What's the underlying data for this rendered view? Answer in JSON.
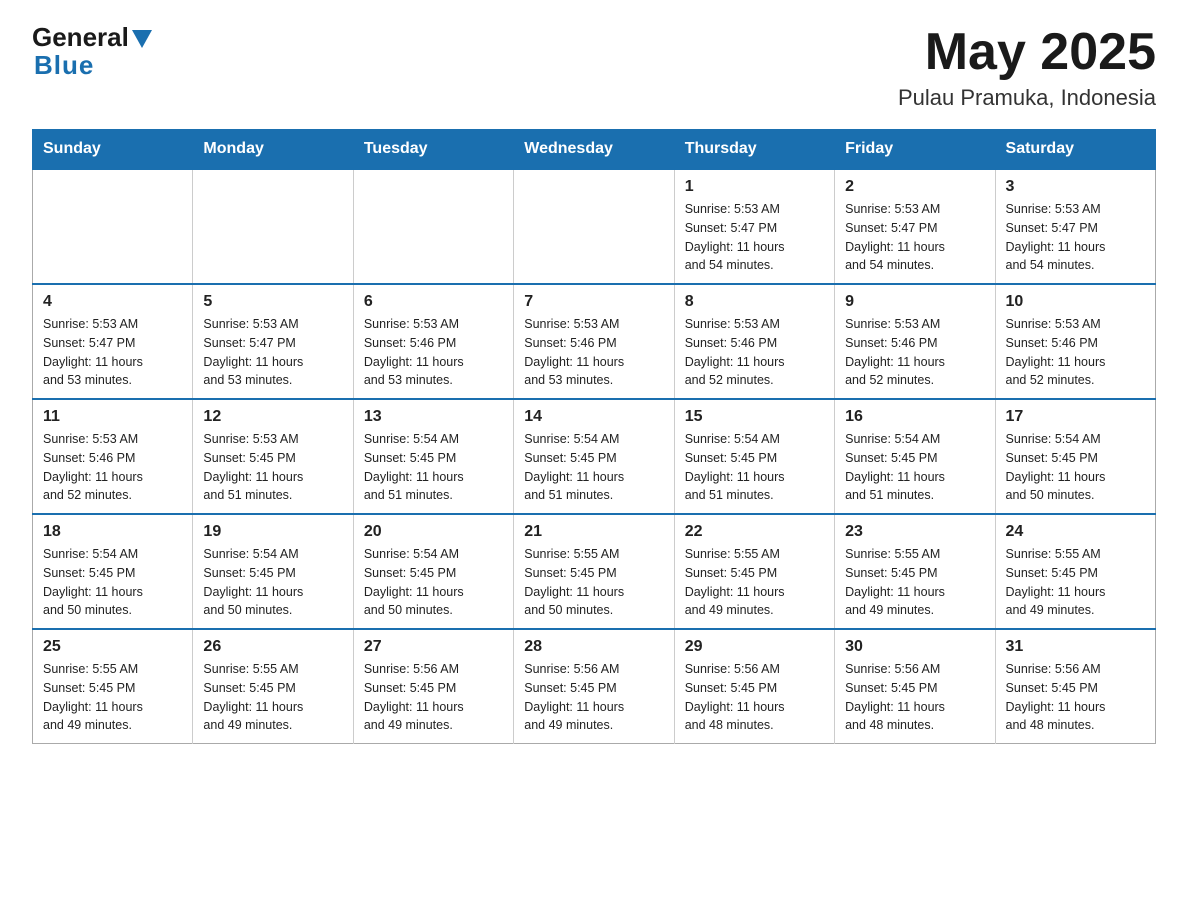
{
  "logo": {
    "general": "General",
    "blue": "Blue"
  },
  "title": "May 2025",
  "subtitle": "Pulau Pramuka, Indonesia",
  "weekdays": [
    "Sunday",
    "Monday",
    "Tuesday",
    "Wednesday",
    "Thursday",
    "Friday",
    "Saturday"
  ],
  "weeks": [
    [
      {
        "day": "",
        "info": ""
      },
      {
        "day": "",
        "info": ""
      },
      {
        "day": "",
        "info": ""
      },
      {
        "day": "",
        "info": ""
      },
      {
        "day": "1",
        "info": "Sunrise: 5:53 AM\nSunset: 5:47 PM\nDaylight: 11 hours\nand 54 minutes."
      },
      {
        "day": "2",
        "info": "Sunrise: 5:53 AM\nSunset: 5:47 PM\nDaylight: 11 hours\nand 54 minutes."
      },
      {
        "day": "3",
        "info": "Sunrise: 5:53 AM\nSunset: 5:47 PM\nDaylight: 11 hours\nand 54 minutes."
      }
    ],
    [
      {
        "day": "4",
        "info": "Sunrise: 5:53 AM\nSunset: 5:47 PM\nDaylight: 11 hours\nand 53 minutes."
      },
      {
        "day": "5",
        "info": "Sunrise: 5:53 AM\nSunset: 5:47 PM\nDaylight: 11 hours\nand 53 minutes."
      },
      {
        "day": "6",
        "info": "Sunrise: 5:53 AM\nSunset: 5:46 PM\nDaylight: 11 hours\nand 53 minutes."
      },
      {
        "day": "7",
        "info": "Sunrise: 5:53 AM\nSunset: 5:46 PM\nDaylight: 11 hours\nand 53 minutes."
      },
      {
        "day": "8",
        "info": "Sunrise: 5:53 AM\nSunset: 5:46 PM\nDaylight: 11 hours\nand 52 minutes."
      },
      {
        "day": "9",
        "info": "Sunrise: 5:53 AM\nSunset: 5:46 PM\nDaylight: 11 hours\nand 52 minutes."
      },
      {
        "day": "10",
        "info": "Sunrise: 5:53 AM\nSunset: 5:46 PM\nDaylight: 11 hours\nand 52 minutes."
      }
    ],
    [
      {
        "day": "11",
        "info": "Sunrise: 5:53 AM\nSunset: 5:46 PM\nDaylight: 11 hours\nand 52 minutes."
      },
      {
        "day": "12",
        "info": "Sunrise: 5:53 AM\nSunset: 5:45 PM\nDaylight: 11 hours\nand 51 minutes."
      },
      {
        "day": "13",
        "info": "Sunrise: 5:54 AM\nSunset: 5:45 PM\nDaylight: 11 hours\nand 51 minutes."
      },
      {
        "day": "14",
        "info": "Sunrise: 5:54 AM\nSunset: 5:45 PM\nDaylight: 11 hours\nand 51 minutes."
      },
      {
        "day": "15",
        "info": "Sunrise: 5:54 AM\nSunset: 5:45 PM\nDaylight: 11 hours\nand 51 minutes."
      },
      {
        "day": "16",
        "info": "Sunrise: 5:54 AM\nSunset: 5:45 PM\nDaylight: 11 hours\nand 51 minutes."
      },
      {
        "day": "17",
        "info": "Sunrise: 5:54 AM\nSunset: 5:45 PM\nDaylight: 11 hours\nand 50 minutes."
      }
    ],
    [
      {
        "day": "18",
        "info": "Sunrise: 5:54 AM\nSunset: 5:45 PM\nDaylight: 11 hours\nand 50 minutes."
      },
      {
        "day": "19",
        "info": "Sunrise: 5:54 AM\nSunset: 5:45 PM\nDaylight: 11 hours\nand 50 minutes."
      },
      {
        "day": "20",
        "info": "Sunrise: 5:54 AM\nSunset: 5:45 PM\nDaylight: 11 hours\nand 50 minutes."
      },
      {
        "day": "21",
        "info": "Sunrise: 5:55 AM\nSunset: 5:45 PM\nDaylight: 11 hours\nand 50 minutes."
      },
      {
        "day": "22",
        "info": "Sunrise: 5:55 AM\nSunset: 5:45 PM\nDaylight: 11 hours\nand 49 minutes."
      },
      {
        "day": "23",
        "info": "Sunrise: 5:55 AM\nSunset: 5:45 PM\nDaylight: 11 hours\nand 49 minutes."
      },
      {
        "day": "24",
        "info": "Sunrise: 5:55 AM\nSunset: 5:45 PM\nDaylight: 11 hours\nand 49 minutes."
      }
    ],
    [
      {
        "day": "25",
        "info": "Sunrise: 5:55 AM\nSunset: 5:45 PM\nDaylight: 11 hours\nand 49 minutes."
      },
      {
        "day": "26",
        "info": "Sunrise: 5:55 AM\nSunset: 5:45 PM\nDaylight: 11 hours\nand 49 minutes."
      },
      {
        "day": "27",
        "info": "Sunrise: 5:56 AM\nSunset: 5:45 PM\nDaylight: 11 hours\nand 49 minutes."
      },
      {
        "day": "28",
        "info": "Sunrise: 5:56 AM\nSunset: 5:45 PM\nDaylight: 11 hours\nand 49 minutes."
      },
      {
        "day": "29",
        "info": "Sunrise: 5:56 AM\nSunset: 5:45 PM\nDaylight: 11 hours\nand 48 minutes."
      },
      {
        "day": "30",
        "info": "Sunrise: 5:56 AM\nSunset: 5:45 PM\nDaylight: 11 hours\nand 48 minutes."
      },
      {
        "day": "31",
        "info": "Sunrise: 5:56 AM\nSunset: 5:45 PM\nDaylight: 11 hours\nand 48 minutes."
      }
    ]
  ]
}
